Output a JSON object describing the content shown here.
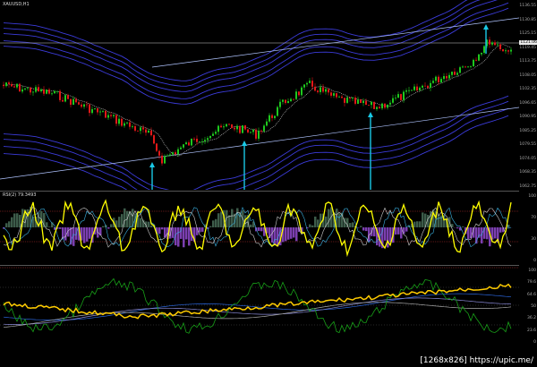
{
  "chart": {
    "symbol": "XAUUSD,H1",
    "price_tag": "1121.06",
    "price_ticks": [
      "1136.55",
      "1130.85",
      "1125.15",
      "1119.45",
      "1113.75",
      "1108.05",
      "1102.35",
      "1096.65",
      "1090.95",
      "1085.25",
      "1079.55",
      "1074.05",
      "1068.35",
      "1062.75"
    ],
    "indicator1_label": "RSI(2) 79.3493",
    "indicator1_ticks": [
      "100",
      "70",
      "30",
      "0"
    ],
    "indicator2_ticks": [
      "100",
      "79.6",
      "64.6",
      "50",
      "36.2",
      "23.6",
      "0"
    ]
  },
  "watermark": "[1268x826] https://upic.me/",
  "colors": {
    "background": "#000000",
    "bull_candle": "#1ec81e",
    "bear_candle": "#e01818",
    "bands": "#3b3bd8",
    "trend": "#b0c4ff",
    "arrow": "#19c9e6",
    "rsi": "#ffff00",
    "histogram": "#7b3fb0",
    "yellow_line": "#ffcc00",
    "green_line": "#18a018"
  }
}
